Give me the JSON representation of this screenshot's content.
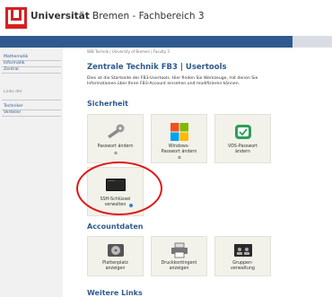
{
  "header": {
    "title_bold": "Universität",
    "title_rest": " Bremen - Fachbereich 3"
  },
  "sidebar": {
    "items": [
      "Mathematik",
      "Informatik",
      "Zentral",
      "Links der",
      "Techniker",
      "Verteiler"
    ]
  },
  "main": {
    "breadcrumb": "WiB Technik | University of Bremen | Faculty 3",
    "heading": "Zentrale Technik FB3 | Usertools",
    "intro": "Dies ist die Startseite der FB3-Usertools. Hier finden Sie Werkzeuge, mit denen Sie Informationen über Ihren FB3-Account einsehen und modifizieren können."
  },
  "sections": {
    "security": "Sicherheit",
    "account": "Accountdaten",
    "links": "Weitere Links"
  },
  "tiles": {
    "password": {
      "line1": "Passwort ändern",
      "line2": ""
    },
    "windows": {
      "line1": "Windows-",
      "line2": "Passwort ändern"
    },
    "vds": {
      "line1": "VDS-Passwort",
      "line2": "ändern"
    },
    "ssh": {
      "line1": "SSH-Schlüssel",
      "line2": "verwalten"
    },
    "disk": {
      "line1": "Plattenplatz",
      "line2": "anzeigen"
    },
    "print": {
      "line1": "Druckkontingent",
      "line2": "anzeigen"
    },
    "groups": {
      "line1": "Gruppen-",
      "line2": "verwaltung"
    }
  },
  "colors": {
    "brand_blue": "#2e5a8f",
    "logo_red": "#d62020",
    "highlight_ring": "#e01717"
  }
}
